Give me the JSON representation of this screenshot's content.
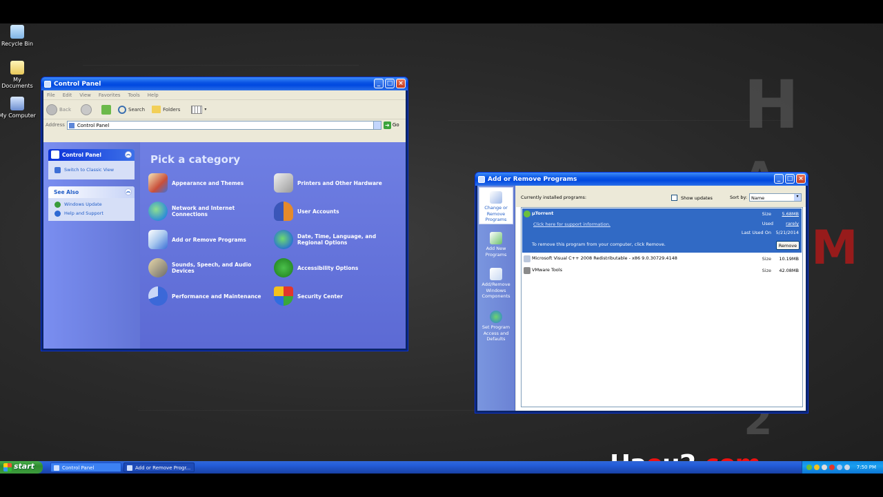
{
  "desktop": {
    "icons": [
      {
        "label": "Recycle Bin",
        "icon": "recycle-bin-icon"
      },
      {
        "label": "My Documents",
        "icon": "folder-icon"
      },
      {
        "label": "My Computer",
        "icon": "computer-icon"
      }
    ],
    "watermark": {
      "part1": "Ha",
      "part2": "o",
      "part3": "u2",
      "part4": ".com"
    }
  },
  "control_panel": {
    "title": "Control Panel",
    "menu": [
      "File",
      "Edit",
      "View",
      "Favorites",
      "Tools",
      "Help"
    ],
    "toolbar": {
      "back": "Back",
      "search": "Search",
      "folders": "Folders"
    },
    "address_label": "Address",
    "address_value": "Control Panel",
    "go_label": "Go",
    "task_pane": {
      "header": "Control Panel",
      "switch_link": "Switch to Classic View",
      "see_also_header": "See Also",
      "see_also": [
        "Windows Update",
        "Help and Support"
      ]
    },
    "heading": "Pick a category",
    "categories": [
      {
        "label": "Appearance and Themes",
        "icon": "appearance-icon"
      },
      {
        "label": "Printers and Other Hardware",
        "icon": "printer-icon"
      },
      {
        "label": "Network and Internet Connections",
        "icon": "network-icon"
      },
      {
        "label": "User Accounts",
        "icon": "user-accounts-icon"
      },
      {
        "label": "Add or Remove Programs",
        "icon": "add-remove-icon"
      },
      {
        "label": "Date, Time, Language, and Regional Options",
        "icon": "date-time-icon"
      },
      {
        "label": "Sounds, Speech, and Audio Devices",
        "icon": "sound-icon"
      },
      {
        "label": "Accessibility Options",
        "icon": "accessibility-icon"
      },
      {
        "label": "Performance and Maintenance",
        "icon": "performance-icon"
      },
      {
        "label": "Security Center",
        "icon": "shield-icon"
      }
    ]
  },
  "add_remove": {
    "title": "Add or Remove Programs",
    "sidebar": [
      {
        "label": "Change or Remove Programs"
      },
      {
        "label": "Add New Programs"
      },
      {
        "label": "Add/Remove Windows Components"
      },
      {
        "label": "Set Program Access and Defaults"
      }
    ],
    "installed_label": "Currently installed programs:",
    "show_updates_label": "Show updates",
    "sort_label": "Sort by:",
    "sort_value": "Name",
    "selected": {
      "name": "µTorrent",
      "support_link": "Click here for support information.",
      "size_label": "Size",
      "size_value": "5.68MB",
      "used_label": "Used",
      "used_value": "rarely",
      "last_used_label": "Last Used On",
      "last_used_value": "5/21/2014",
      "remove_text": "To remove this program from your computer, click Remove.",
      "remove_button": "Remove"
    },
    "programs": [
      {
        "name": "Microsoft Visual C++ 2008 Redistributable - x86 9.0.30729.4148",
        "size_label": "Size",
        "size": "10.19MB"
      },
      {
        "name": "VMware Tools",
        "size_label": "Size",
        "size": "42.08MB"
      }
    ]
  },
  "taskbar": {
    "start_label": "start",
    "tasks": [
      "Control Panel",
      "Add or Remove Progr..."
    ],
    "clock": "7:50 PM"
  }
}
